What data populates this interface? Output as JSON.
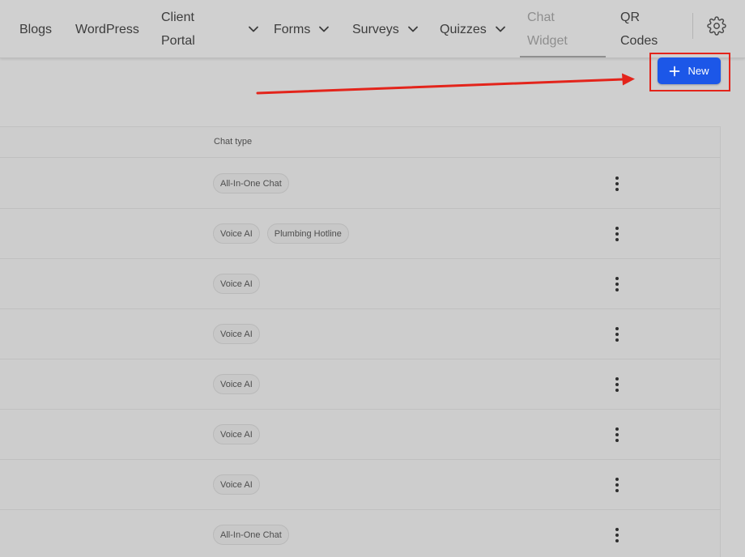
{
  "nav": {
    "items": [
      {
        "id": "blogs",
        "lines": [
          "Blogs"
        ],
        "dropdown": false,
        "active": false
      },
      {
        "id": "wordpress",
        "lines": [
          "WordPress"
        ],
        "dropdown": false,
        "active": false
      },
      {
        "id": "client-portal",
        "lines": [
          "Client",
          "Portal"
        ],
        "dropdown": true,
        "active": false
      },
      {
        "id": "forms",
        "lines": [
          "Forms"
        ],
        "dropdown": true,
        "active": false
      },
      {
        "id": "surveys",
        "lines": [
          "Surveys"
        ],
        "dropdown": true,
        "active": false
      },
      {
        "id": "quizzes",
        "lines": [
          "Quizzes"
        ],
        "dropdown": true,
        "active": false
      },
      {
        "id": "chat-widget",
        "lines": [
          "Chat",
          "Widget"
        ],
        "dropdown": false,
        "active": true
      },
      {
        "id": "qr-codes",
        "lines": [
          "QR",
          "Codes"
        ],
        "dropdown": false,
        "active": false
      }
    ],
    "settings_icon": "gear-icon"
  },
  "toolbar": {
    "new_label": "New",
    "new_icon": "plus-icon"
  },
  "table": {
    "columns": [
      "Chat type"
    ],
    "rows": [
      {
        "chat_types": [
          "All-In-One Chat"
        ]
      },
      {
        "chat_types": [
          "Voice AI",
          "Plumbing Hotline"
        ]
      },
      {
        "chat_types": [
          "Voice AI"
        ]
      },
      {
        "chat_types": [
          "Voice AI"
        ]
      },
      {
        "chat_types": [
          "Voice AI"
        ]
      },
      {
        "chat_types": [
          "Voice AI"
        ]
      },
      {
        "chat_types": [
          "Voice AI"
        ]
      },
      {
        "chat_types": [
          "All-In-One Chat"
        ]
      }
    ],
    "row_menu_icon": "more-vertical-icon"
  },
  "colors": {
    "accent": "#1c57e8",
    "annotation": "#e3241b",
    "background": "#cfcfcf"
  }
}
